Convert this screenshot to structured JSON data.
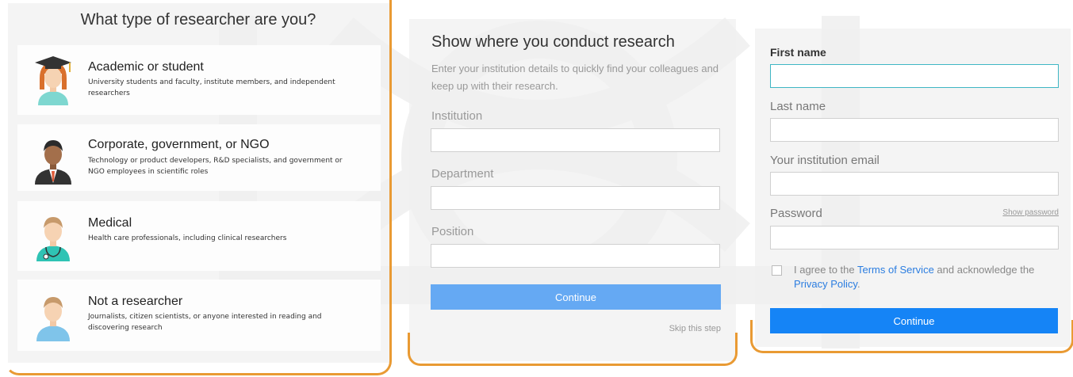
{
  "colors": {
    "accent_orange": "#e99a33",
    "primary_button": "#1584f6",
    "disabled_button": "#65a9f3",
    "link": "#2b7de0",
    "focus_border": "#3fb6c4"
  },
  "researcher_types": {
    "title": "What type of researcher are you?",
    "options": [
      {
        "title": "Academic or student",
        "desc": "University students and faculty, institute members, and independent researchers",
        "icon": "academic-avatar-icon"
      },
      {
        "title": "Corporate, government, or NGO",
        "desc": "Technology or product developers, R&D specialists, and government or NGO employees in scientific roles",
        "icon": "corporate-avatar-icon"
      },
      {
        "title": "Medical",
        "desc": "Health care professionals, including clinical researchers",
        "icon": "medical-avatar-icon"
      },
      {
        "title": "Not a researcher",
        "desc": "Journalists, citizen scientists, or anyone interested in reading and discovering research",
        "icon": "person-avatar-icon"
      }
    ]
  },
  "institution": {
    "title": "Show where you conduct research",
    "subtitle": "Enter your institution details to quickly find your colleagues and keep up with their research.",
    "institution_label": "Institution",
    "institution_value": "",
    "department_label": "Department",
    "department_value": "",
    "position_label": "Position",
    "position_value": "",
    "continue_label": "Continue",
    "skip_label": "Skip this step"
  },
  "signup": {
    "first_name_label": "First name",
    "first_name_value": "",
    "last_name_label": "Last name",
    "last_name_value": "",
    "email_label": "Your institution email",
    "email_value": "",
    "password_label": "Password",
    "password_value": "",
    "show_password_label": "Show password",
    "agree_prefix": "I agree to the ",
    "terms_link": "Terms of Service",
    "agree_middle": " and acknowledge the ",
    "privacy_link": "Privacy Policy",
    "agree_suffix": ".",
    "continue_label": "Continue"
  }
}
